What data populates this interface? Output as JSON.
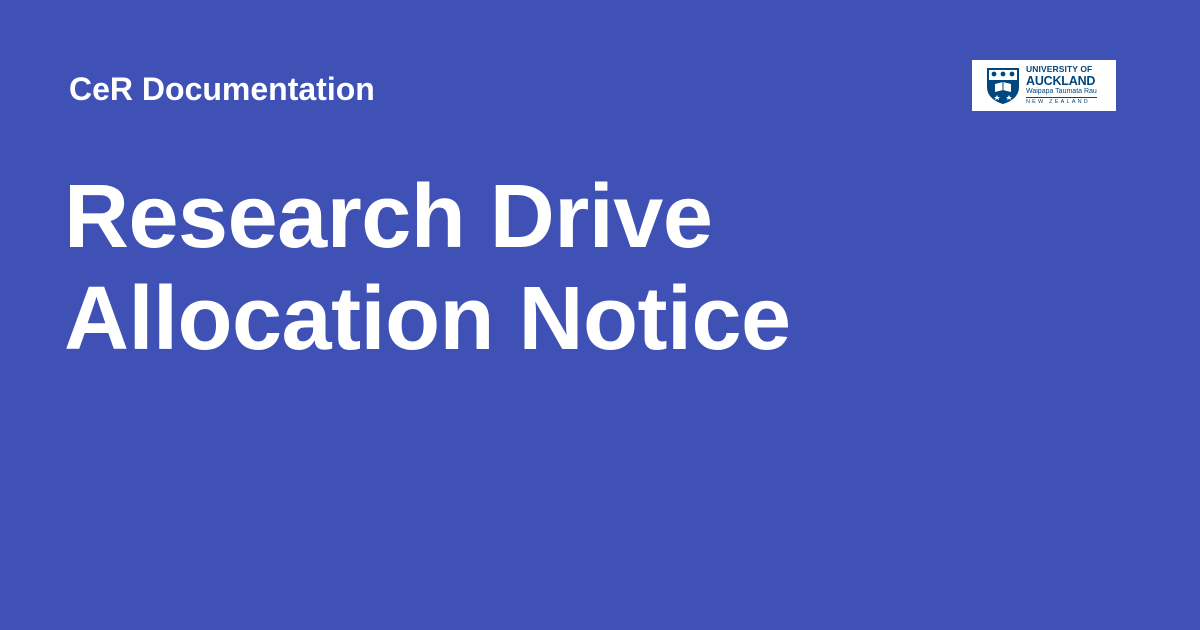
{
  "header": {
    "site_name": "CeR Documentation"
  },
  "main": {
    "title_lines": [
      "Research Drive",
      "Allocation Notice"
    ]
  },
  "logo": {
    "icon": "university-crest-icon",
    "line1": "UNIVERSITY OF",
    "line2": "AUCKLAND",
    "line3": "Waipapa Taumata Rau",
    "line4": "NEW ZEALAND"
  },
  "colors": {
    "background": "#4051b5",
    "text": "#ffffff",
    "logo_blue": "#00467f"
  }
}
